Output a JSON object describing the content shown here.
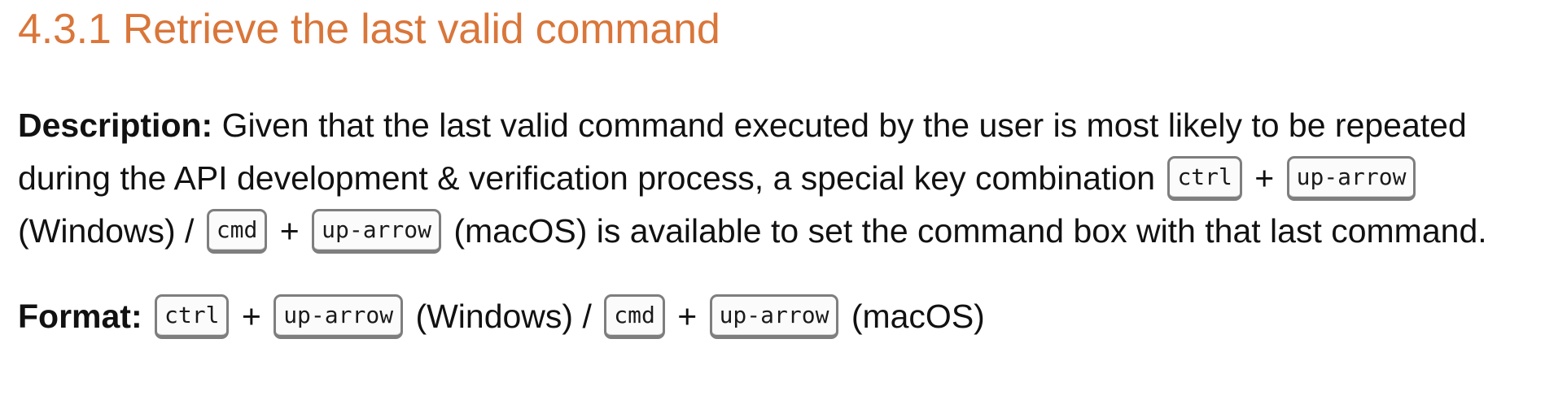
{
  "heading": "4.3.1 Retrieve the last valid command",
  "description": {
    "label": "Description:",
    "text_1": " Given that the last valid command executed by the user is most likely to be repeated during the API development & verification process, a special key combination ",
    "key_ctrl": "ctrl",
    "plus_1": " + ",
    "key_up_1": "up-arrow",
    "mid_1": " (Windows) / ",
    "key_cmd": "cmd",
    "plus_2": " + ",
    "key_up_2": "up-arrow",
    "text_2": " (macOS) is available to set the command box with that last command."
  },
  "format": {
    "label": "Format:",
    "key_ctrl": "ctrl",
    "plus_1": " + ",
    "key_up_1": "up-arrow",
    "mid_1": " (Windows) / ",
    "key_cmd": "cmd",
    "plus_2": " + ",
    "key_up_2": "up-arrow",
    "tail": " (macOS)"
  },
  "colors": {
    "heading": "#d9763a",
    "body_text": "#111111",
    "key_border": "#7e7e7e"
  }
}
